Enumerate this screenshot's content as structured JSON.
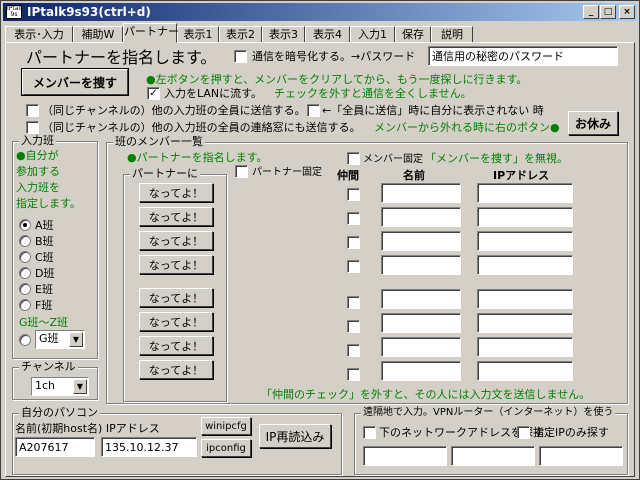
{
  "window": {
    "title": "IPtalk9s93(ctrl+d)",
    "icon_text": "IPtalk 9s"
  },
  "tabs": [
    "表示･入力",
    "補助W",
    "パートナー",
    "表示1",
    "表示2",
    "表示3",
    "表示4",
    "入力1",
    "保存",
    "説明"
  ],
  "header": {
    "title": "パートナーを指名します。",
    "encrypt_label": "通信を暗号化する。→パスワード",
    "password_value": "通信用の秘密のパスワード",
    "find_members_button": "メンバーを捜す",
    "find_hint": "●左ボタンを押すと、メンバーをクリアしてから、もう一度探しに行きます。",
    "lan_label": "入力をLANに流す。",
    "lan_hint": "チェックを外すと通信を全くしません。"
  },
  "options": {
    "send_all_label": "（同じチャンネルの）他の入力班の全員に送信する。",
    "self_show_label": "←「全員に送信」時に自分に表示されない 時",
    "contact_label": "（同じチャンネルの）他の入力班の全員の連絡窓にも送信する。",
    "rest_hint": "メンバーから外れる時に右のボタン●",
    "rest_button": "お休み"
  },
  "input_group": {
    "label": "入力班",
    "hint": [
      "●自分が",
      "参加する",
      "入力班を",
      "指定します。"
    ],
    "teams": [
      "A班",
      "B班",
      "C班",
      "D班",
      "E班",
      "F班"
    ],
    "selected_team": "A班",
    "gz_label": "G班～Z班",
    "gz_value": "G班"
  },
  "channel": {
    "label": "チャンネル",
    "value": "1ch"
  },
  "members": {
    "label": "班のメンバー一覧",
    "partner_hint": "●パートナーを指名します。",
    "partner_sublabel": "パートナーに",
    "partner_buttons": [
      "なってよ！",
      "なってよ！",
      "なってよ！",
      "なってよ！",
      "なってよ！",
      "なってよ！",
      "なってよ！",
      "なってよ！"
    ],
    "partner_fixed_label": "パートナー固定",
    "member_fixed_label": "メンバー固定",
    "member_fixed_hint": "「メンバーを捜す」を無視。",
    "col_friend": "仲間",
    "col_name": "名前",
    "col_ip": "IPアドレス",
    "footer_hint": "「仲間のチェック」を外すと、その人には入力文を送信しません。"
  },
  "pc": {
    "label": "自分のパソコン",
    "desc": "名前(初期host名) IPアドレス",
    "name_value": "A207617",
    "ip_value": "135.10.12.37",
    "winipcfg_button": "winipcfg",
    "ipconfig_button": "ipconfig",
    "reload_button": "IP再読込み"
  },
  "remote": {
    "label": "遠隔地で入力。VPNルーター（インターネット）を使う",
    "network_label": "下のネットワークアドレスを探す",
    "ip_only_label": "指定IPのみ探す"
  }
}
